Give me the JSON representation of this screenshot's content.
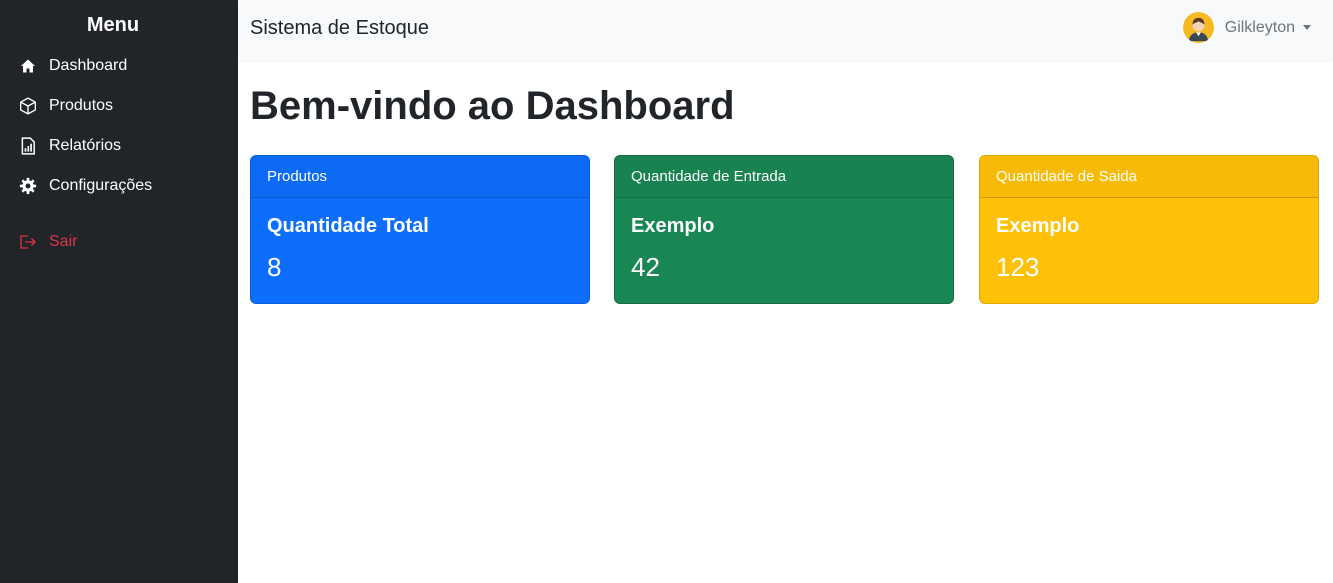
{
  "sidebar": {
    "title": "Menu",
    "items": [
      {
        "label": "Dashboard",
        "icon": "house-icon"
      },
      {
        "label": "Produtos",
        "icon": "box-icon"
      },
      {
        "label": "Relatórios",
        "icon": "report-icon"
      },
      {
        "label": "Configurações",
        "icon": "gear-icon"
      }
    ],
    "logout": {
      "label": "Sair",
      "icon": "logout-icon",
      "color": "#dc3545"
    }
  },
  "header": {
    "brand": "Sistema de Estoque",
    "user": "Gilkleyton"
  },
  "main": {
    "title": "Bem-vindo ao Dashboard",
    "cards": [
      {
        "header": "Produtos",
        "subtitle": "Quantidade Total",
        "value": "8",
        "color": "#0d6efd"
      },
      {
        "header": "Quantidade de Entrada",
        "subtitle": "Exemplo",
        "value": "42",
        "color": "#198754"
      },
      {
        "header": "Quantidade de Saida",
        "subtitle": "Exemplo",
        "value": "123",
        "color": "#ffc107"
      }
    ]
  }
}
